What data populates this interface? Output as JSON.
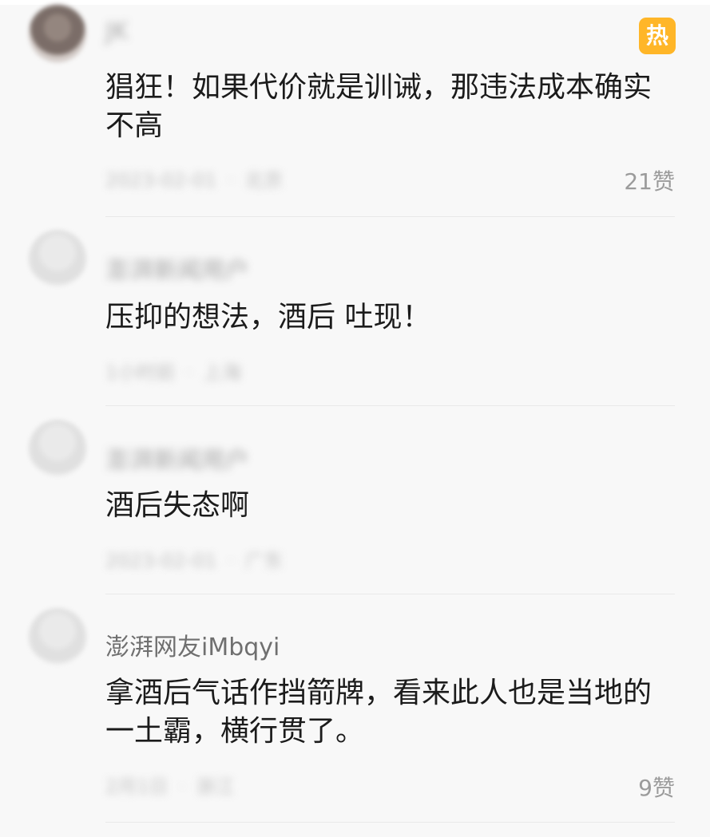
{
  "hot_badge": "热",
  "comments": [
    {
      "author": "JK",
      "text": "猖狂！如果代价就是训诫，那违法成本确实不高",
      "date": "2023-02-01",
      "location": "北京",
      "likes": "21赞"
    },
    {
      "author": "澎湃新闻用户",
      "text": "压抑的想法，酒后 吐现！",
      "date": "1小时前",
      "location": "上海",
      "likes": ""
    },
    {
      "author": "澎湃新闻用户",
      "text": "酒后失态啊",
      "date": "2023-02-01",
      "location": "广东",
      "likes": ""
    },
    {
      "author": "澎湃网友iMbqyi",
      "text": "拿酒后气话作挡箭牌，看来此人也是当地的一土霸，横行贯了。",
      "date": "2月1日",
      "location": "浙江",
      "likes": "9赞"
    }
  ]
}
